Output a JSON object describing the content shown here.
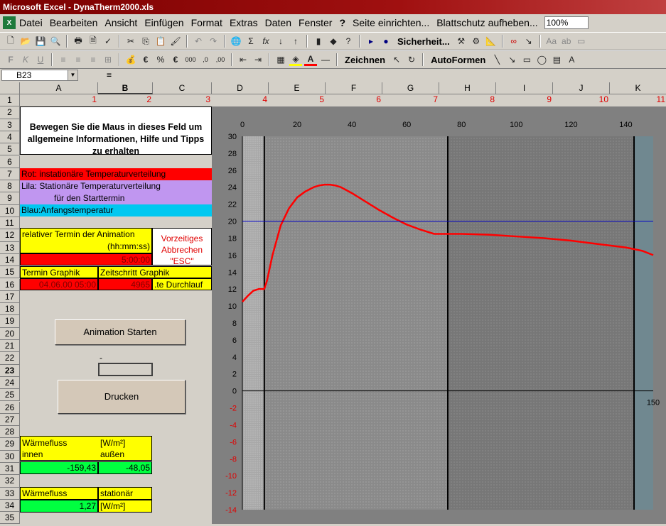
{
  "window": {
    "title": "Microsoft Excel - DynaTherm2000.xls"
  },
  "menu": [
    "Datei",
    "Bearbeiten",
    "Ansicht",
    "Einfügen",
    "Format",
    "Extras",
    "Daten",
    "Fenster",
    "?",
    "Seite einrichten...",
    "Blattschutz aufheben..."
  ],
  "zoom": "100%",
  "toolbar": {
    "security_label": "Sicherheit...",
    "draw_label": "Zeichnen",
    "autoshapes_label": "AutoFormen"
  },
  "formula_bar": {
    "namebox": "B23",
    "equals": "="
  },
  "columns": [
    "A",
    "B",
    "C",
    "D",
    "E",
    "F",
    "G",
    "H",
    "I",
    "J",
    "K"
  ],
  "rows": [
    "1",
    "2",
    "3",
    "4",
    "5",
    "6",
    "7",
    "8",
    "9",
    "10",
    "11",
    "12",
    "13",
    "14",
    "15",
    "16",
    "17",
    "18",
    "19",
    "20",
    "21",
    "22",
    "23",
    "24",
    "25",
    "26",
    "27",
    "28",
    "29",
    "30",
    "31",
    "32",
    "33",
    "34",
    "35"
  ],
  "row1_numbers": [
    "1",
    "2",
    "3",
    "4",
    "5",
    "6",
    "7",
    "8",
    "9",
    "10",
    "11"
  ],
  "sheet": {
    "info_box": "Bewegen Sie die Maus in dieses Feld um allgemeine Informationen, Hilfe und Tipps zu erhalten",
    "legend_red": "Rot:   instationäre Temperaturverteilung",
    "legend_purple_1": "Lila:   Stationäre Temperaturverteilung",
    "legend_purple_2": "für den Starttermin",
    "legend_blue": "Blau:Anfangstemperatur",
    "rel_termin_label": "relativer Termin der Animation",
    "rel_termin_unit": "(hh:mm:ss)",
    "rel_termin_value": "5:00:00",
    "abort_1": "Vorzeitiges",
    "abort_2": "Abbrechen",
    "abort_3": "\"ESC\"",
    "termin_graphik_label": "Termin Graphik",
    "zeitschritt_label": "Zeitschritt Graphik",
    "termin_graphik_value": "04.06.00 05:00",
    "zeitschritt_value": "4965",
    "durchlauf_label": ".te Durchlauf",
    "animation_button": "Animation Starten",
    "dash": "-",
    "print_button": "Drucken",
    "waermefluss_label": "Wärmefluss",
    "waermefluss_unit": "[W/m²]",
    "innen_label": "innen",
    "aussen_label": "außen",
    "innen_value": "-159,43",
    "aussen_value": "-48,05",
    "waermefluss2_label": "Wärmefluss",
    "stationaer_label": "stationär",
    "stationaer_value": "1,27",
    "stationaer_unit": "[W/m²]"
  },
  "colors": {
    "red": "#ff0000",
    "purple": "#c096f0",
    "cyan": "#00c8f0",
    "yellow": "#ffff00",
    "green": "#00ff40",
    "chart_bg": "#808080",
    "blue_line": "#0000c8"
  },
  "chart_data": {
    "type": "line",
    "x_top_ticks": [
      "0",
      "20",
      "40",
      "60",
      "80",
      "100",
      "120",
      "140"
    ],
    "x_bottom_ticks": [
      "150"
    ],
    "y_ticks": [
      "30",
      "28",
      "26",
      "24",
      "22",
      "20",
      "18",
      "16",
      "14",
      "12",
      "10",
      "8",
      "6",
      "4",
      "2",
      "0",
      "-2",
      "-4",
      "-6",
      "-8",
      "-10",
      "-12",
      "-14"
    ],
    "xlim": [
      0,
      150
    ],
    "ylim": [
      -14,
      30
    ],
    "layers": [
      0,
      8,
      75,
      143,
      150
    ],
    "series": [
      {
        "color": "red",
        "x": [
          0,
          2,
          4,
          6,
          8,
          9,
          11,
          14,
          17,
          20,
          23,
          26,
          28,
          30,
          32,
          34,
          36,
          40,
          45,
          50,
          55,
          60,
          65,
          70,
          75,
          80,
          90,
          100,
          110,
          120,
          130,
          140,
          143,
          146,
          150
        ],
        "y": [
          10.5,
          11.2,
          11.8,
          12.0,
          12.0,
          13,
          16,
          19.5,
          21.5,
          22.8,
          23.5,
          24.0,
          24.2,
          24.3,
          24.3,
          24.2,
          24.0,
          23.3,
          22.3,
          21.3,
          20.4,
          19.6,
          19.0,
          18.5,
          18.5,
          18.5,
          18.4,
          18.2,
          18.0,
          17.7,
          17.3,
          16.9,
          16.7,
          16.5,
          16.0
        ]
      },
      {
        "color": "blue",
        "x": [
          0,
          150
        ],
        "y": [
          20,
          20
        ]
      }
    ]
  }
}
